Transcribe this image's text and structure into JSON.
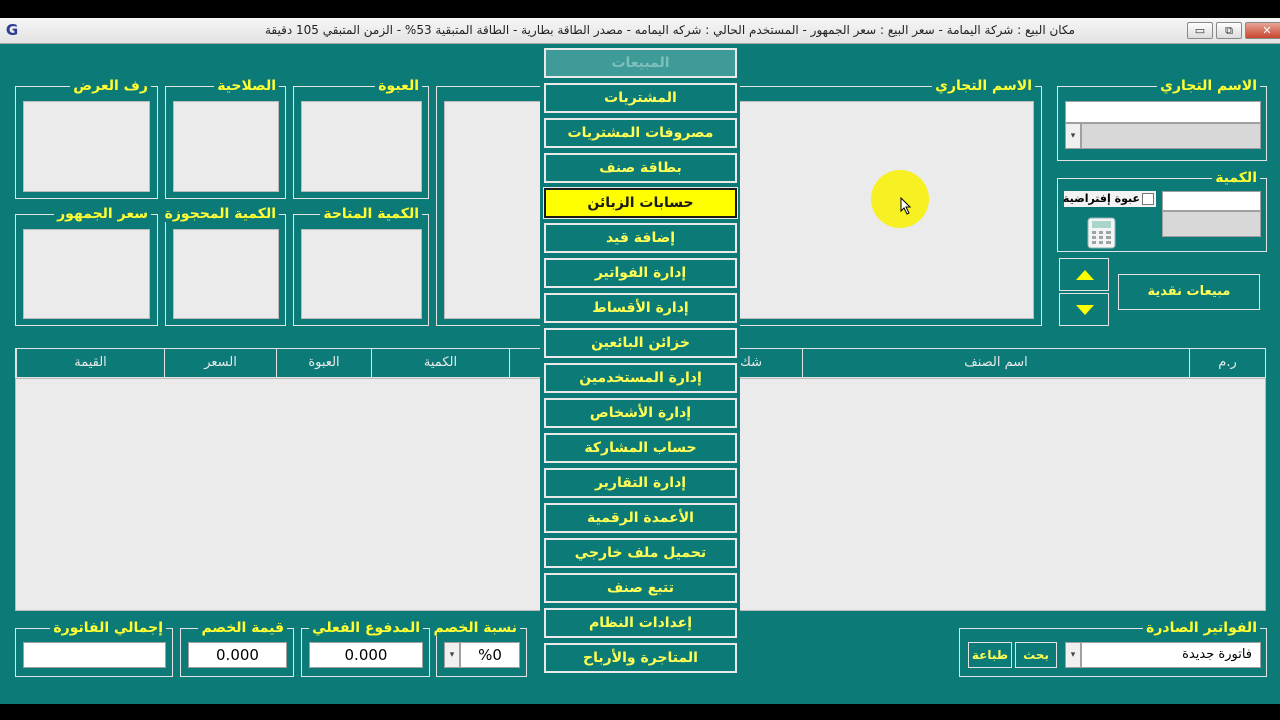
{
  "window": {
    "title": "مكان البيع : شركة اليمامة - سعر البيع : سعر الجمهور - المستخدم الحالي : شركه اليمامه  -  مصدر الطاقة بطارية  -  الطاقة المتبقية 53%  -  الزمن المتبقي 105 دقيقة",
    "logo": "G",
    "minimize": "▭",
    "restore": "⧉",
    "close": "✕"
  },
  "product_panel": {
    "display_edge_label": "رف العرض",
    "expiry_label": "الصلاحية",
    "package_label": "العبوة",
    "trade_name_label": "الاسم التجاري",
    "public_price_label": "سعر الجمهور",
    "reserved_qty_label": "الكمية المحجوزة",
    "available_qty_label": "الكمية المتاحة"
  },
  "entry_panel": {
    "trade_name_label": "الاسم التجاري",
    "quantity_label": "الكمية",
    "default_package_label": "عبوة إفتراضية",
    "cash_sales_button": "مبيعات نقدية"
  },
  "grid": {
    "columns": [
      "ر.م",
      "اسم الصنف",
      "شك",
      "الكمية",
      "العبوة",
      "السعر",
      "القيمة"
    ]
  },
  "menu": {
    "items": [
      {
        "label": "المبيعات",
        "state": "disabled"
      },
      {
        "label": "المشتريات",
        "state": "normal"
      },
      {
        "label": "مصروفات المشتريات",
        "state": "normal"
      },
      {
        "label": "بطاقة صنف",
        "state": "normal"
      },
      {
        "label": "حسابات الزبائن",
        "state": "selected"
      },
      {
        "label": "إضافة قيد",
        "state": "normal"
      },
      {
        "label": "إدارة الفواتير",
        "state": "normal"
      },
      {
        "label": "إدارة الأقساط",
        "state": "normal"
      },
      {
        "label": "خزائن البائعين",
        "state": "normal"
      },
      {
        "label": "إدارة المستخدمين",
        "state": "normal"
      },
      {
        "label": "إدارة الأشخاص",
        "state": "normal"
      },
      {
        "label": "حساب المشاركة",
        "state": "normal"
      },
      {
        "label": "إدارة التقارير",
        "state": "normal"
      },
      {
        "label": "الأعمدة الرقمية",
        "state": "normal"
      },
      {
        "label": "تحميل ملف خارجي",
        "state": "normal"
      },
      {
        "label": "تتبع صنف",
        "state": "normal"
      },
      {
        "label": "إعدادات النظام",
        "state": "normal"
      },
      {
        "label": "المتاجرة والأرباح",
        "state": "normal"
      }
    ]
  },
  "totals": {
    "invoice_total_label": "إجمالي الفاتورة",
    "invoice_total_value": "",
    "discount_value_label": "قيمة الخصم",
    "discount_value": "0.000",
    "actual_paid_label": "المدفوع الفعلي",
    "actual_paid_value": "0.000",
    "discount_rate_label": "نسبة الخصم",
    "discount_rate_value": "%0"
  },
  "issued_invoices": {
    "label": "الفواتير الصادرة",
    "selected_value": "فاتورة جديدة",
    "search_button": "بحث",
    "print_button": "طباعة"
  },
  "colors": {
    "background": "#0c7b78",
    "label": "#ffff33",
    "selected_item": "#ffff00"
  },
  "icons": {
    "app_logo": "app-logo-icon",
    "calculator": "calculator-icon",
    "up_arrow": "arrow-up-icon",
    "down_arrow": "arrow-down-icon",
    "mouse_pointer": "cursor-icon"
  }
}
